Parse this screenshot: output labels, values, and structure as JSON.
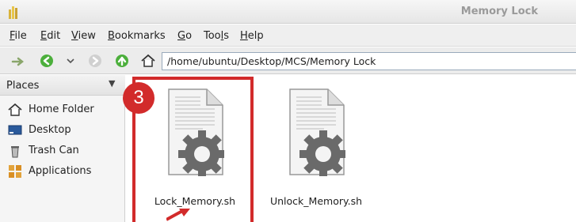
{
  "window": {
    "title": "Memory Lock"
  },
  "menubar": {
    "items": [
      {
        "label": "File",
        "mnemonic": "F",
        "rest": "ile"
      },
      {
        "label": "Edit",
        "mnemonic": "E",
        "rest": "dit"
      },
      {
        "label": "View",
        "mnemonic": "V",
        "rest": "iew"
      },
      {
        "label": "Bookmarks",
        "mnemonic": "B",
        "rest": "ookmarks"
      },
      {
        "label": "Go",
        "mnemonic": "G",
        "rest": "o"
      },
      {
        "label": "Tools",
        "pre": "Too",
        "mnemonic": "l",
        "rest": "s"
      },
      {
        "label": "Help",
        "mnemonic": "H",
        "rest": "elp"
      }
    ]
  },
  "toolbar": {
    "location_path": "/home/ubuntu/Desktop/MCS/Memory Lock"
  },
  "sidebar": {
    "header": "Places",
    "items": [
      {
        "label": "Home Folder",
        "icon": "home-icon"
      },
      {
        "label": "Desktop",
        "icon": "desktop-icon"
      },
      {
        "label": "Trash Can",
        "icon": "trash-icon"
      },
      {
        "label": "Applications",
        "icon": "applications-icon"
      }
    ]
  },
  "files": [
    {
      "name": "Lock_Memory.sh",
      "icon": "shell-script-icon"
    },
    {
      "name": "Unlock_Memory.sh",
      "icon": "shell-script-icon"
    }
  ],
  "annotation": {
    "step_number": "3",
    "color": "#d22b2b"
  }
}
